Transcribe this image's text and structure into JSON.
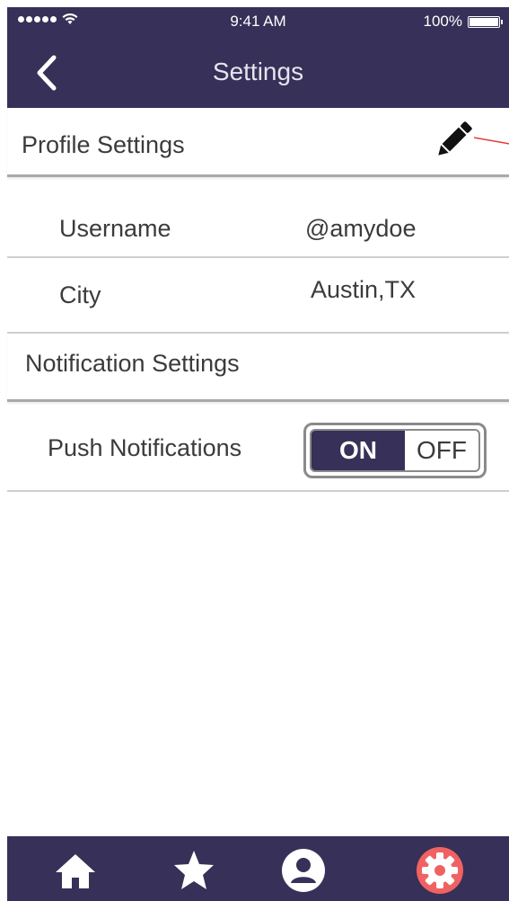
{
  "status_bar": {
    "time": "9:41 AM",
    "battery": "100%"
  },
  "nav": {
    "title": "Settings",
    "back_icon": "chevron-left-icon"
  },
  "profile_section": {
    "title": "Profile Settings",
    "edit_icon": "pencil-icon",
    "rows": [
      {
        "label": "Username",
        "value": "@amydoe"
      },
      {
        "label": "City",
        "value": "Austin,TX"
      }
    ]
  },
  "notification_section": {
    "title": "Notification Settings",
    "push": {
      "label": "Push Notifications",
      "on_label": "ON",
      "off_label": "OFF",
      "state": "on"
    }
  },
  "tab_bar": {
    "items": [
      {
        "name": "home",
        "icon": "home-icon",
        "active": false
      },
      {
        "name": "favorites",
        "icon": "star-icon",
        "active": false
      },
      {
        "name": "profile",
        "icon": "user-icon",
        "active": false
      },
      {
        "name": "settings",
        "icon": "gear-icon",
        "active": true
      }
    ]
  },
  "colors": {
    "primary": "#373058",
    "active_tab": "#f06262",
    "annotation_line": "#e23b3b"
  }
}
